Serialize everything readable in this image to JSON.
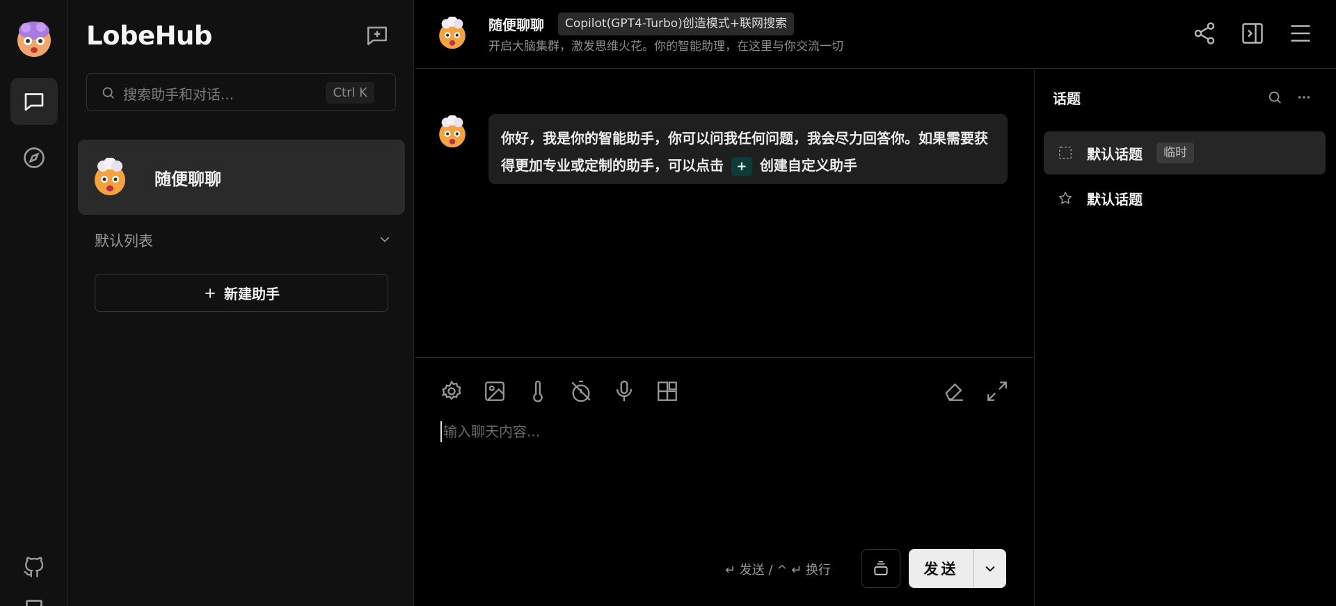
{
  "sidebar": {
    "logo": "LobeHub",
    "search": {
      "placeholder": "搜索助手和对话...",
      "shortcut": "Ctrl K"
    },
    "sessions": [
      {
        "name": "随便聊聊"
      }
    ],
    "group": {
      "title": "默认列表"
    },
    "new_assistant_label": "新建助手"
  },
  "header": {
    "title": "随便聊聊",
    "tag": "Copilot(GPT4-Turbo)创造模式+联网搜索",
    "description": "开启大脑集群，激发思维火花。你的智能助理，在这里与你交流一切"
  },
  "chat": {
    "messages": [
      {
        "text_before": "你好，我是你的智能助手，你可以问我任何问题，我会尽力回答你。如果需要获得更加专业或定制的助手，可以点击",
        "inline_button": "+",
        "text_after": "创建自定义助手"
      }
    ]
  },
  "composer": {
    "placeholder": "输入聊天内容...",
    "hint": "↵ 发送 / ^ ↵ 换行",
    "send_label": "发送"
  },
  "topics": {
    "title": "话题",
    "items": [
      {
        "label": "默认话题",
        "badge": "临时",
        "icon": "dashed-square-icon"
      },
      {
        "label": "默认话题",
        "icon": "star-icon"
      }
    ]
  },
  "colors": {
    "background": "#000000",
    "panel": "#111111",
    "active": "#2a2a2a",
    "inline_button": "#0f3b36",
    "send_button": "#ededed"
  }
}
